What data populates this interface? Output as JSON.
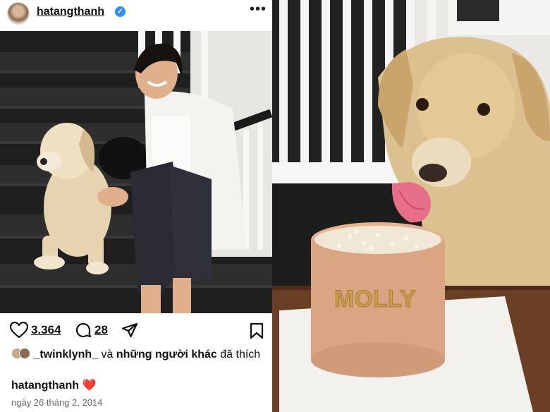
{
  "post": {
    "username": "hatangthanh",
    "likes_count": "3.364",
    "comments_count": "28",
    "liked_by_user": "_twinklynh_",
    "liked_by_text_1": " và ",
    "liked_by_others": "những người khác",
    "liked_by_text_2": " đã thích",
    "caption_user": "hatangthanh",
    "caption_emoji": "❤️",
    "date": "ngày 26 tháng 2, 2014"
  },
  "cake": {
    "lettering": "MOLLY"
  },
  "icons": {
    "verified": "verified-badge-icon",
    "more": "more-options-icon",
    "like": "heart-icon",
    "comment": "comment-icon",
    "share": "share-icon",
    "save": "bookmark-icon"
  },
  "colors": {
    "verified_blue": "#2f8ff0",
    "heart_red": "#e0243a"
  }
}
